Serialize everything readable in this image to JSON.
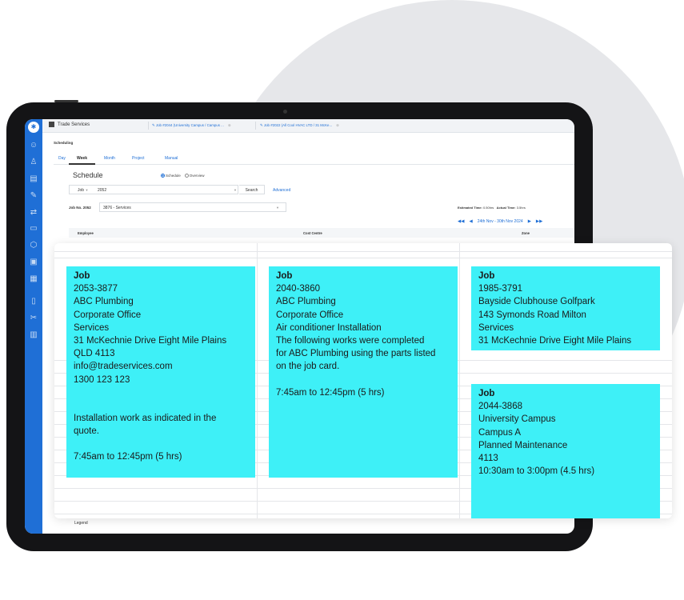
{
  "tabs": {
    "home": "Trade Services",
    "job1": "Job #2044 (University Campus / Campus ...",
    "job2": "Job #2022 (All Cool HVAC LTD / 31 McKe..."
  },
  "page_title": "Scheduling",
  "views": [
    "Day",
    "Week",
    "Month",
    "Project",
    "Manual"
  ],
  "active_view": "Week",
  "schedule": {
    "heading": "Schedule",
    "radio_schedule": "Schedule",
    "radio_overview": "Overview",
    "search_type": "Job",
    "search_value": "2052",
    "search_button": "Search",
    "advanced_link": "Advanced",
    "job_no_label": "Job No. 2052",
    "job_select": "3876 - Services",
    "estimated_label": "Estimated Time:",
    "estimated_value": "0.50hrs",
    "actual_label": "Actual Time:",
    "actual_value": "3.5hrs",
    "date_range": "24th Nov - 30th Nov 2024"
  },
  "columns": [
    "Employee",
    "Cost Centre",
    "Zone"
  ],
  "legend": "Legend",
  "blocks": [
    {
      "title": "Job",
      "lines": [
        "2053-3877",
        "ABC Plumbing",
        "Corporate Office",
        "Services",
        "31 McKechnie Drive Eight Mile Plains",
        "QLD 4113",
        "info@tradeservices.com",
        "1300 123 123",
        "",
        "",
        "Installation work as indicated in the",
        "quote.",
        "",
        "7:45am to 12:45pm (5 hrs)"
      ]
    },
    {
      "title": "Job",
      "lines": [
        "2040-3860",
        "ABC Plumbing",
        "Corporate Office",
        "Air conditioner Installation",
        "The following works were completed",
        "for ABC Plumbing using the parts listed",
        "on the job card.",
        "",
        "7:45am to 12:45pm (5 hrs)"
      ]
    },
    {
      "title": "Job",
      "lines": [
        "1985-3791",
        "Bayside Clubhouse Golfpark",
        "143 Symonds Road Milton",
        "Services",
        "31 McKechnie Drive Eight Mile Plains"
      ]
    },
    {
      "title": "Job",
      "lines": [
        "2044-3868",
        "University Campus",
        "Campus A",
        "Planned Maintenance",
        "4113",
        "10:30am to 3:00pm (4.5 hrs)"
      ]
    }
  ],
  "colors": {
    "sidebar": "#1f6fd6",
    "event": "#3ef0f7",
    "link": "#1f6fd6"
  },
  "sidebar_icons": [
    "users-icon",
    "user-plus-icon",
    "document-icon",
    "wrench-icon",
    "sync-icon",
    "calendar-icon",
    "box-icon",
    "clipboard-icon",
    "invoice-icon",
    "file-icon",
    "tools-icon",
    "chart-icon"
  ]
}
